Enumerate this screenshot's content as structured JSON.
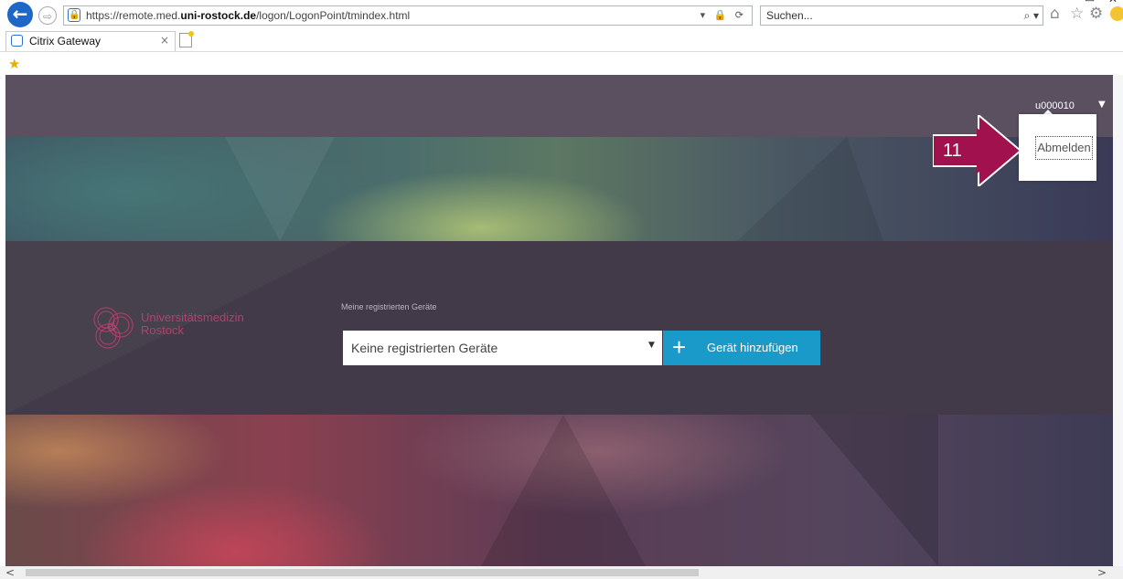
{
  "browser": {
    "url_prefix": "https://remote.med.",
    "url_host": "uni-rostock.de",
    "url_path": "/logon/LogonPoint/tmindex.html",
    "address_tools": "▾ 🔒 ⟳",
    "search_placeholder": "Suchen...",
    "search_icon": "⌕ ▾",
    "tab_title": "Citrix Gateway",
    "tab_close": "×",
    "icons": [
      "back-arrow-icon",
      "forward-arrow-icon",
      "home-icon",
      "favorites-star-icon",
      "settings-gear-icon",
      "smiley-feedback-icon",
      "add-favorites-icon"
    ]
  },
  "header": {
    "username": "u000010",
    "menu": {
      "logout_label": "Abmelden"
    }
  },
  "annotation": {
    "step_number": "11"
  },
  "logo": {
    "line1": "Universitätsmedizin",
    "line2": "Rostock",
    "color": "#c1406e"
  },
  "devices": {
    "section_label": "Meine registrierten Geräte",
    "selected_value": "Keine registrierten Geräte",
    "add_button_label": "Gerät hinzufügen",
    "accent_color": "#1a9ac9"
  }
}
